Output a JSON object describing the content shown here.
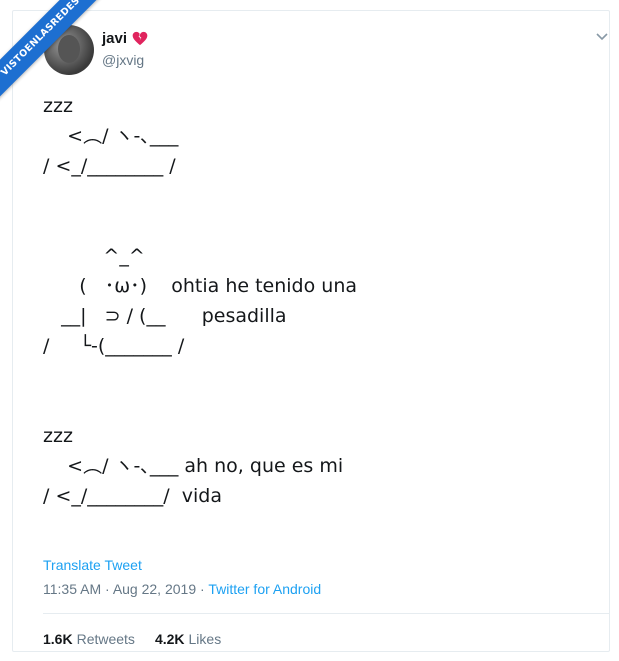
{
  "watermark": {
    "text": "VISTOENLASREDES",
    "color": "#1d6fd1"
  },
  "author": {
    "display_name": "javi",
    "name_emoji": "broken-heart-icon",
    "handle": "@jxvig"
  },
  "tweet": {
    "text": "zzz\n    <︵/ ヽ-､___\n/ <_/________ /\n\n\n          ^_^\n      (   ･ω･)    ohtia he tenido una\n   __|   ⊃ / (__      pesadilla\n/     └-(_______ /\n\n\nzzz\n    <︵/ ヽ-､___ ah no, que es mi\n/ <_/________/  vida",
    "translate_label": "Translate Tweet",
    "time": "11:35 AM",
    "separator": "·",
    "date": "Aug 22, 2019",
    "source": "Twitter for Android"
  },
  "stats": {
    "retweets_count": "1.6K",
    "retweets_label": "Retweets",
    "likes_count": "4.2K",
    "likes_label": "Likes"
  },
  "colors": {
    "link": "#1da1f2",
    "secondary": "#657786",
    "text": "#14171a",
    "heart": "#e0245e"
  }
}
